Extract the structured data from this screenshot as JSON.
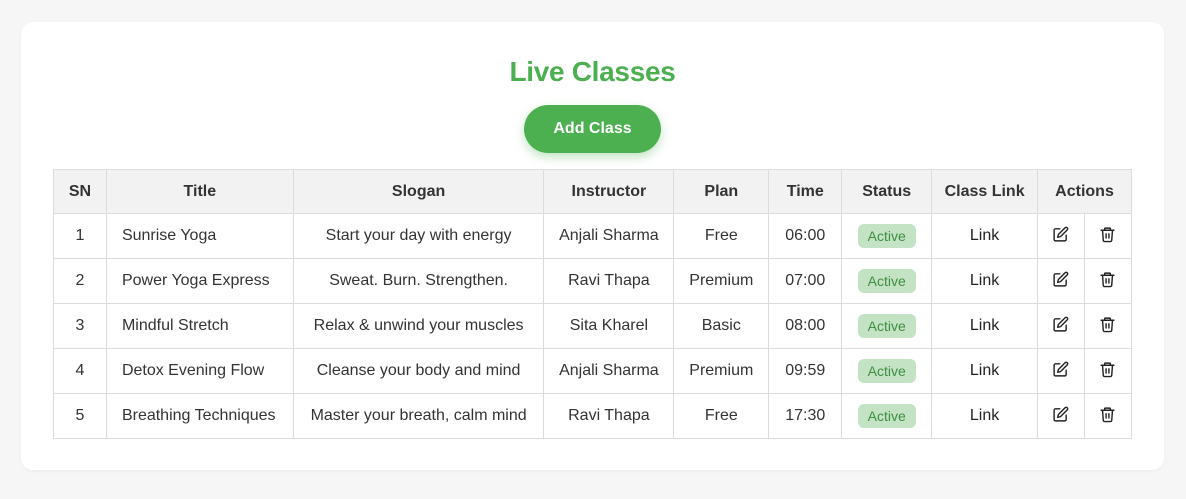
{
  "page": {
    "title": "Live Classes",
    "add_button": "Add Class"
  },
  "table": {
    "headers": [
      "SN",
      "Title",
      "Slogan",
      "Instructor",
      "Plan",
      "Time",
      "Status",
      "Class Link",
      "Actions"
    ],
    "rows": [
      {
        "sn": "1",
        "title": "Sunrise Yoga",
        "slogan": "Start your day with energy",
        "instructor": "Anjali Sharma",
        "plan": "Free",
        "time": "06:00",
        "status": "Active",
        "link": "Link"
      },
      {
        "sn": "2",
        "title": "Power Yoga Express",
        "slogan": "Sweat. Burn. Strengthen.",
        "instructor": "Ravi Thapa",
        "plan": "Premium",
        "time": "07:00",
        "status": "Active",
        "link": "Link"
      },
      {
        "sn": "3",
        "title": "Mindful Stretch",
        "slogan": "Relax & unwind your muscles",
        "instructor": "Sita Kharel",
        "plan": "Basic",
        "time": "08:00",
        "status": "Active",
        "link": "Link"
      },
      {
        "sn": "4",
        "title": "Detox Evening Flow",
        "slogan": "Cleanse your body and mind",
        "instructor": "Anjali Sharma",
        "plan": "Premium",
        "time": "09:59",
        "status": "Active",
        "link": "Link"
      },
      {
        "sn": "5",
        "title": "Breathing Techniques",
        "slogan": "Master your breath, calm mind",
        "instructor": "Ravi Thapa",
        "plan": "Free",
        "time": "17:30",
        "status": "Active",
        "link": "Link"
      }
    ],
    "row_icons": {
      "edit": "edit-icon",
      "delete": "trash-icon"
    }
  },
  "colors": {
    "accent": "#4caf50",
    "status_bg": "#c3e3c4",
    "status_text": "#3e8e41"
  }
}
